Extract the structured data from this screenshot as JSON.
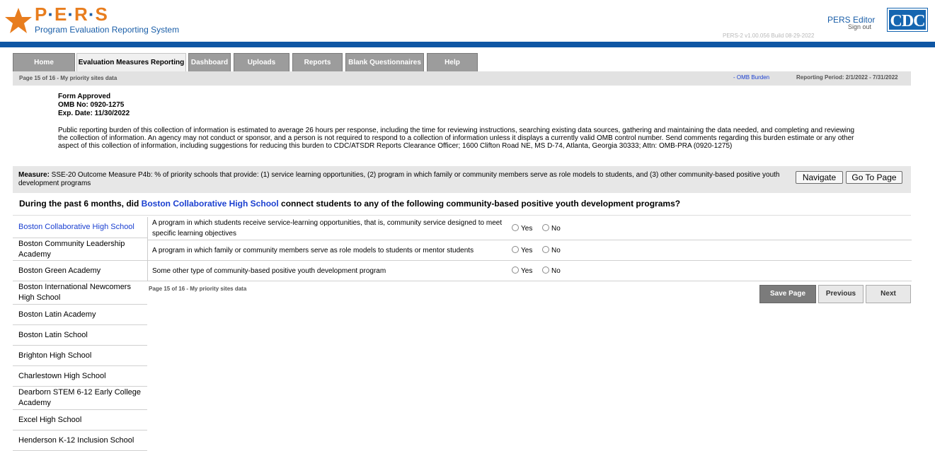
{
  "header": {
    "logo_text": "P·E·R·S",
    "logo_letters": [
      "P",
      "E",
      "R",
      "S"
    ],
    "logo_subtitle": "Program Evaluation Reporting System",
    "user_role": "PERS Editor",
    "sign_out": "Sign out",
    "cdc": "CDC",
    "version": "PERS-2 v1.00.056    Build 08-29-2022",
    "colors": {
      "brand_orange": "#e87d1e",
      "brand_blue": "#1a5ea8",
      "header_bar": "#0f56a4"
    }
  },
  "tabs": [
    {
      "label": "Home",
      "active": false
    },
    {
      "label": "Evaluation Measures Reporting",
      "active": true
    },
    {
      "label": "Dashboard",
      "active": false
    },
    {
      "label": "Uploads",
      "active": false
    },
    {
      "label": "Reports",
      "active": false
    },
    {
      "label": "Blank Questionnaires",
      "active": false
    },
    {
      "label": "Help",
      "active": false
    }
  ],
  "subbar": {
    "page_info": "Page 15 of 16 - My priority sites data",
    "omb_link": "- OMB Burden",
    "reporting_period": "Reporting Period: 2/1/2022 - 7/31/2022"
  },
  "form": {
    "approved": "Form Approved",
    "omb_no": "OMB No: 0920-1275",
    "exp_date": "Exp. Date: 11/30/2022",
    "burden_statement": "Public reporting burden of this collection of information is estimated to average 26 hours per response, including the time for reviewing instructions, searching existing data sources, gathering and maintaining the data needed, and completing and reviewing the collection of information. An agency may not conduct or sponsor, and a person is not required to respond to a collection of information unless it displays a currently valid OMB control number. Send comments regarding this burden estimate or any other aspect of this collection of information, including suggestions for reducing this burden to CDC/ATSDR Reports Clearance Officer; 1600 Clifton Road NE, MS D-74, Atlanta, Georgia 30333; Attn: OMB-PRA (0920-1275)"
  },
  "measure": {
    "label": "Measure:",
    "text": " SSE-20 Outcome Measure P4b: % of priority schools that provide: (1) service learning opportunities, (2) program in which family or community members serve as role models to students, and (3) other community-based positive youth development programs",
    "navigate_label": "Navigate",
    "goto_label": "Go To Page"
  },
  "question": {
    "prefix": "During the past 6 months, did ",
    "school": "Boston Collaborative High School",
    "suffix": " connect students to any of the following community-based positive youth development programs?"
  },
  "sidebar": {
    "items": [
      {
        "label": "Boston Collaborative High School",
        "active": true
      },
      {
        "label": "Boston Community Leadership Academy",
        "active": false
      },
      {
        "label": "Boston Green Academy",
        "active": false
      },
      {
        "label": "Boston International Newcomers High School",
        "active": false
      },
      {
        "label": "Boston Latin Academy",
        "active": false
      },
      {
        "label": "Boston Latin School",
        "active": false
      },
      {
        "label": "Brighton High School",
        "active": false
      },
      {
        "label": "Charlestown High School",
        "active": false
      },
      {
        "label": "Dearborn STEM 6-12 Early College Academy",
        "active": false
      },
      {
        "label": "Excel High School",
        "active": false
      },
      {
        "label": "Henderson K-12 Inclusion School",
        "active": false
      }
    ]
  },
  "questions": [
    {
      "text": "A program in which students receive service-learning opportunities, that is, community service designed to meet specific learning objectives",
      "yes": "Yes",
      "no": "No"
    },
    {
      "text": "A program in which family or community members serve as role models to students or mentor students",
      "yes": "Yes",
      "no": "No"
    },
    {
      "text": "Some other type of community-based positive youth development program",
      "yes": "Yes",
      "no": "No"
    }
  ],
  "footer": {
    "page_info": "Page 15 of 16 - My priority sites data",
    "save_label": "Save Page",
    "previous_label": "Previous",
    "next_label": "Next"
  }
}
